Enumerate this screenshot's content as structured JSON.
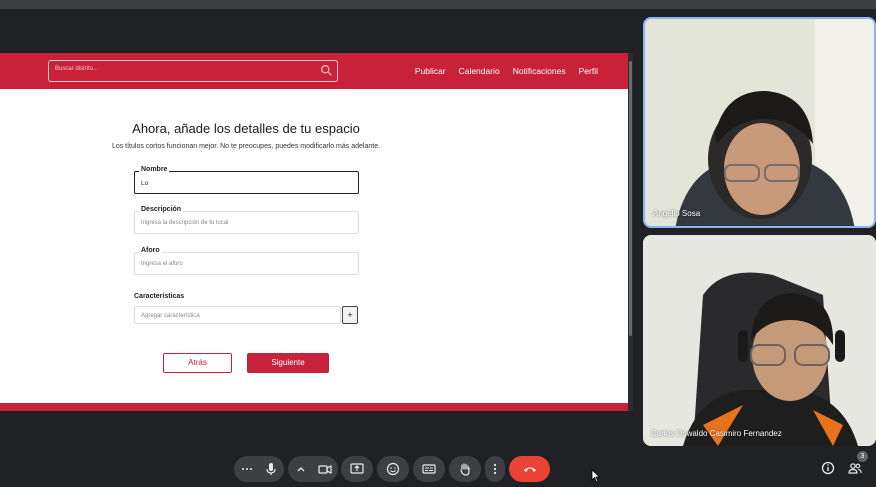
{
  "app": {
    "navbar": {
      "search_placeholder": "Buscar distrito...",
      "links": [
        "Publicar",
        "Calendario",
        "Notificaciones",
        "Perfil"
      ]
    },
    "form": {
      "title": "Ahora, añade los detalles de tu espacio",
      "subtitle": "Los títulos cortos funcionan mejor. No te preocupes, puedes modificarlo más adelante.",
      "nombre_label": "Nombre",
      "nombre_value": "Lo",
      "descripcion_label": "Descripción",
      "descripcion_placeholder": "Ingresa la descripción de tu local",
      "aforo_label": "Aforo",
      "aforo_placeholder": "Ingresa el aforo",
      "caracteristicas_label": "Características",
      "caracteristicas_placeholder": "Agregar característica",
      "add_label": "+",
      "back_label": "Atrás",
      "next_label": "Siguiente"
    }
  },
  "participants": [
    {
      "name": "Angello Sosa",
      "speaking": true
    },
    {
      "name": "Carlos Oswaldo Casimiro Fernandez",
      "speaking": false
    }
  ],
  "meeting_controls": {
    "people_count": "3",
    "hangup_color": "#ea4335",
    "icons": [
      "more-dots-icon",
      "microphone-icon",
      "chevron-up-icon",
      "camera-icon",
      "present-screen-icon",
      "emoji-icon",
      "captions-icon",
      "raise-hand-icon",
      "more-vert-icon",
      "hangup-icon",
      "info-icon",
      "people-icon"
    ]
  },
  "colors": {
    "brand_red": "#c8213a",
    "meet_bg": "#202124",
    "speaking_border": "#8ab4f8"
  }
}
